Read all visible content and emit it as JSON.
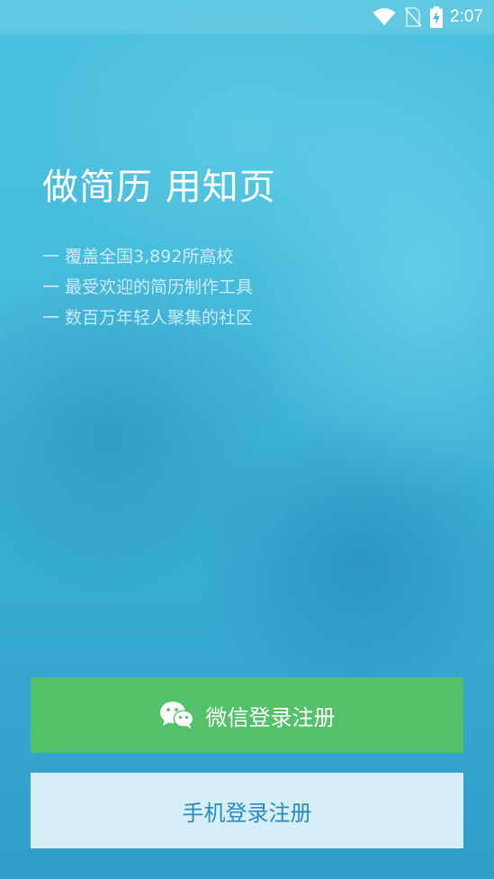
{
  "status_bar": {
    "time": "2:07",
    "icons": [
      "wifi-icon",
      "no-sim-icon",
      "battery-charging-icon"
    ]
  },
  "headline": "做简历 用知页",
  "features": [
    "一 覆盖全国3,892所高校",
    "一 最受欢迎的简历制作工具",
    "一 数百万年轻人聚集的社区"
  ],
  "buttons": {
    "wechat_login": "微信登录注册",
    "phone_login": "手机登录注册"
  },
  "colors": {
    "wechat_button": "#55c06a",
    "phone_button": "#d6eef7",
    "phone_button_text": "#2a8bc0"
  }
}
